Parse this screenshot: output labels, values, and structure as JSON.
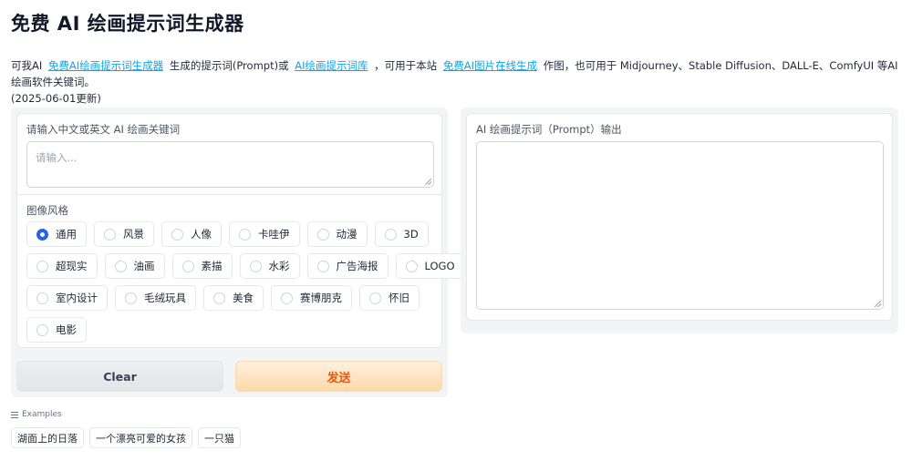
{
  "page": {
    "title": "免费 AI 绘画提示词生成器",
    "desc": {
      "prefix": "可我AI",
      "link1": "免费AI绘画提示词生成器",
      "mid1": "生成的提示词(Prompt)或",
      "link2": "AI绘画提示词库",
      "mid2": "，可用于本站",
      "link3": "免费AI图片在线生成",
      "suffix": "作图，也可用于 Midjourney、Stable Diffusion、DALL-E、ComfyUI 等AI绘画软件关键词。",
      "date": "(2025-06-01更新)"
    }
  },
  "input": {
    "label": "请输入中文或英文 AI 绘画关键词",
    "placeholder": "请输入..."
  },
  "style": {
    "label": "图像风格",
    "selected": "通用",
    "rows": [
      [
        "通用",
        "风景",
        "人像",
        "卡哇伊",
        "动漫",
        "3D"
      ],
      [
        "超现实",
        "油画",
        "素描",
        "水彩",
        "广告海报",
        "LOGO"
      ],
      [
        "室内设计",
        "毛绒玩具",
        "美食",
        "赛博朋克",
        "怀旧"
      ],
      [
        "电影"
      ]
    ]
  },
  "buttons": {
    "clear": "Clear",
    "send": "发送"
  },
  "output": {
    "label": "AI 绘画提示词（Prompt）输出",
    "value": ""
  },
  "examples": {
    "label": "Examples",
    "items": [
      "湖面上的日落",
      "一个漂亮可爱的女孩",
      "一只猫"
    ]
  },
  "colors": {
    "link": "#0ea5e9",
    "radio_selected": "#2563eb",
    "send_text": "#ea580c"
  }
}
